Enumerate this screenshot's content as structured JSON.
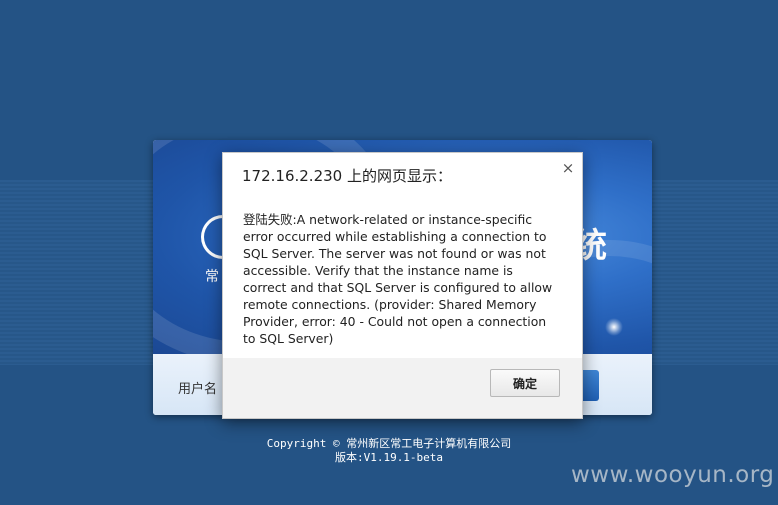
{
  "login_page": {
    "logo_char": "常",
    "title_glyph": "统",
    "username_label": "用户名"
  },
  "footer": {
    "copyright": "Copyright © 常州新区常工电子计算机有限公司",
    "version": "版本:V1.19.1-beta"
  },
  "watermark": "www.wooyun.org",
  "dialog": {
    "title": "172.16.2.230 上的网页显示：",
    "message": "登陆失败:A network-related or instance-specific error occurred while establishing a connection to SQL Server. The server was not found or was not accessible. Verify that the instance name is correct and that SQL Server is configured to allow remote connections. (provider: Shared Memory Provider, error: 40 - Could not open a connection to SQL Server)",
    "close_glyph": "×",
    "ok_label": "确定"
  },
  "colors": {
    "page_background": "#245385",
    "banner_blue": "#2f6fc8",
    "dialog_footer": "#f2f2f2"
  },
  "icons": {
    "close": "close-icon",
    "logo": "logo-ring-icon"
  }
}
